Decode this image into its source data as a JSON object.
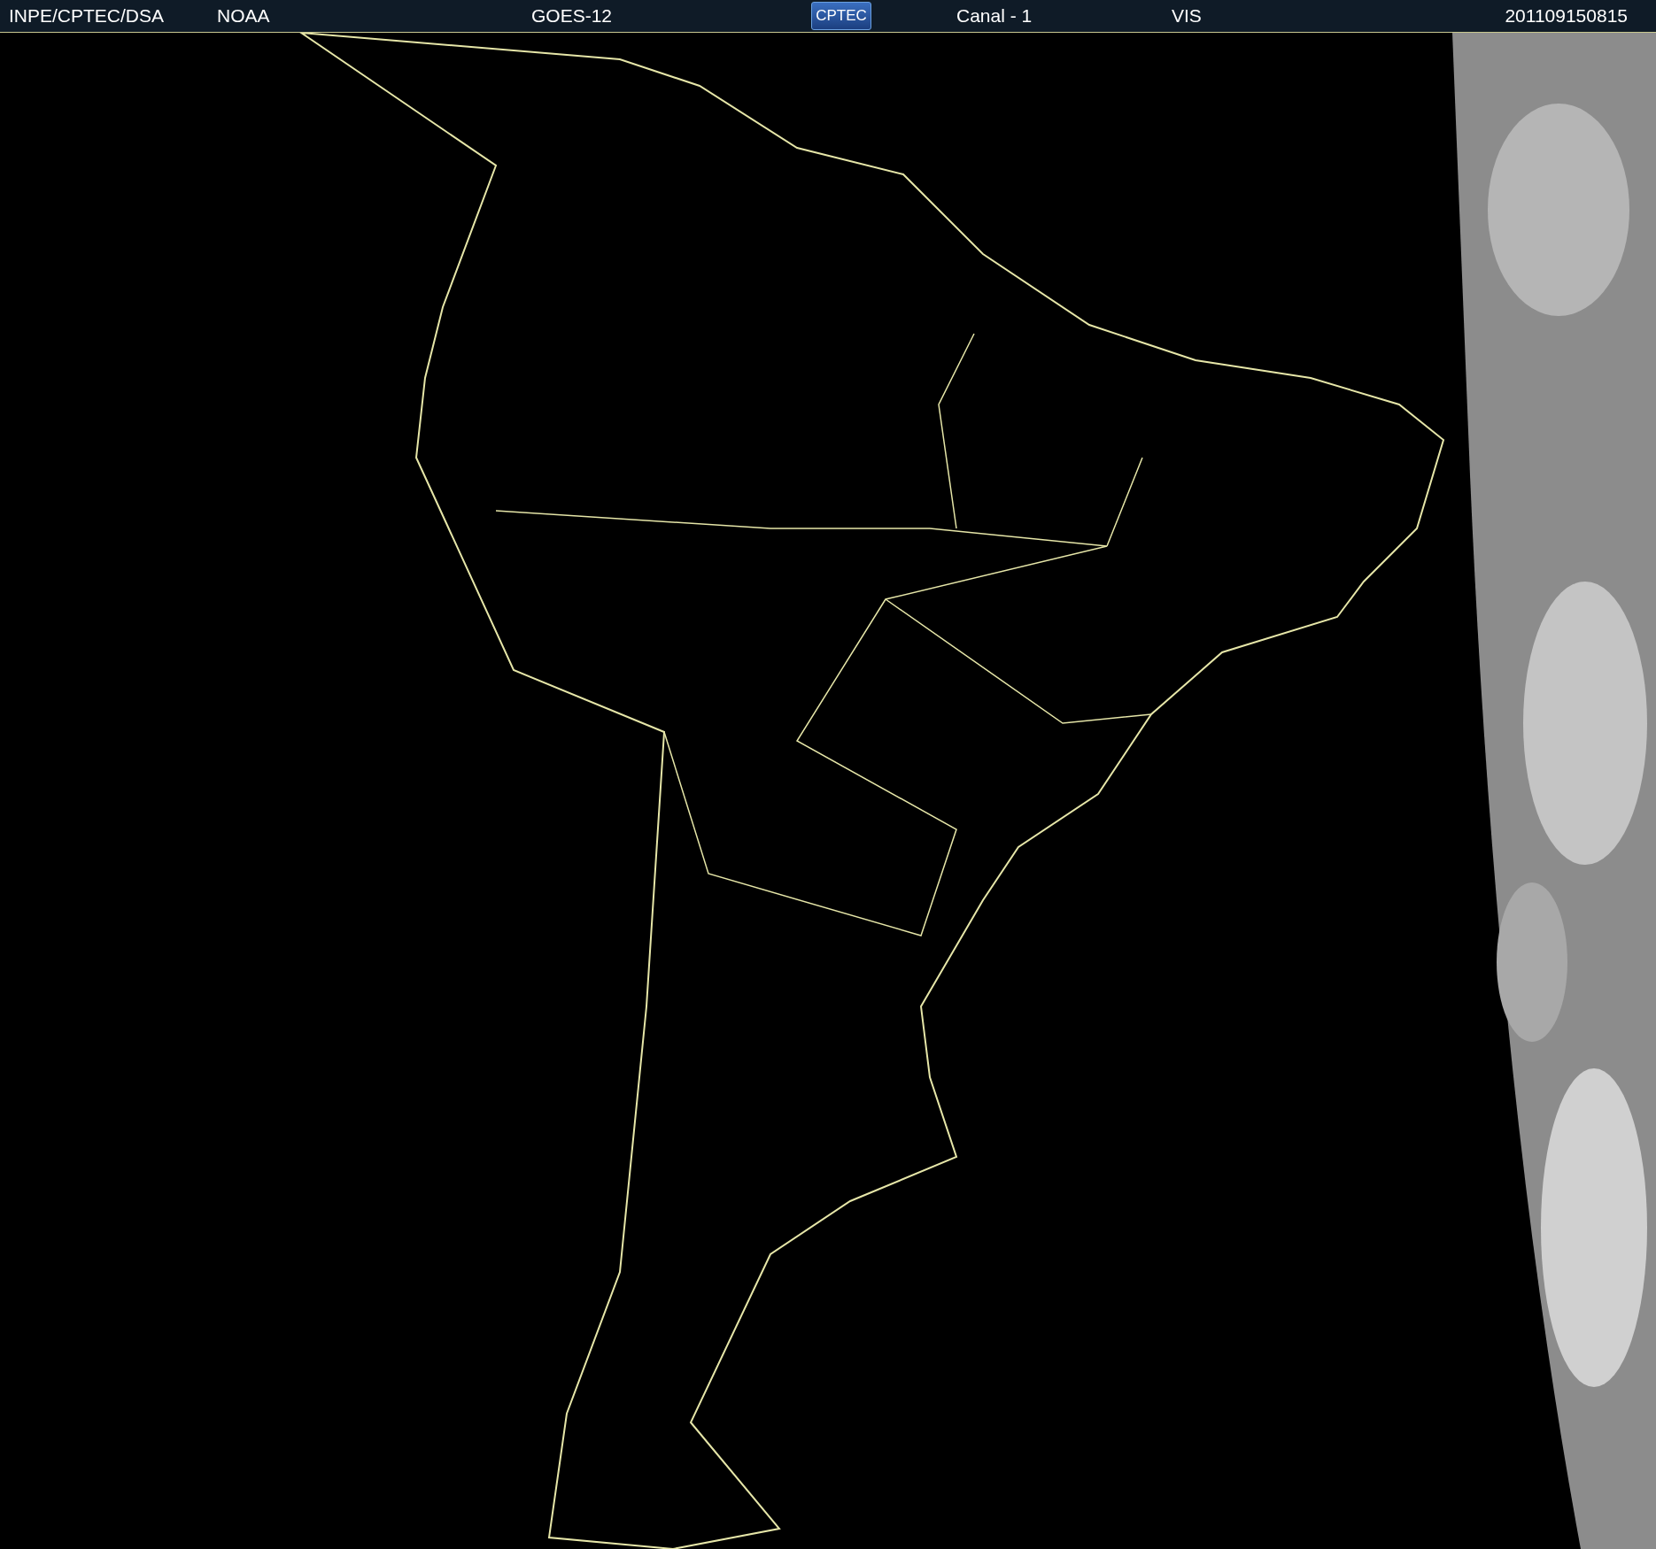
{
  "header": {
    "source": "INPE/CPTEC/DSA",
    "agency": "NOAA",
    "satellite": "GOES-12",
    "logo": "CPTEC",
    "channel": "Canal - 1",
    "band": "VIS",
    "timestamp": "201109150815"
  }
}
